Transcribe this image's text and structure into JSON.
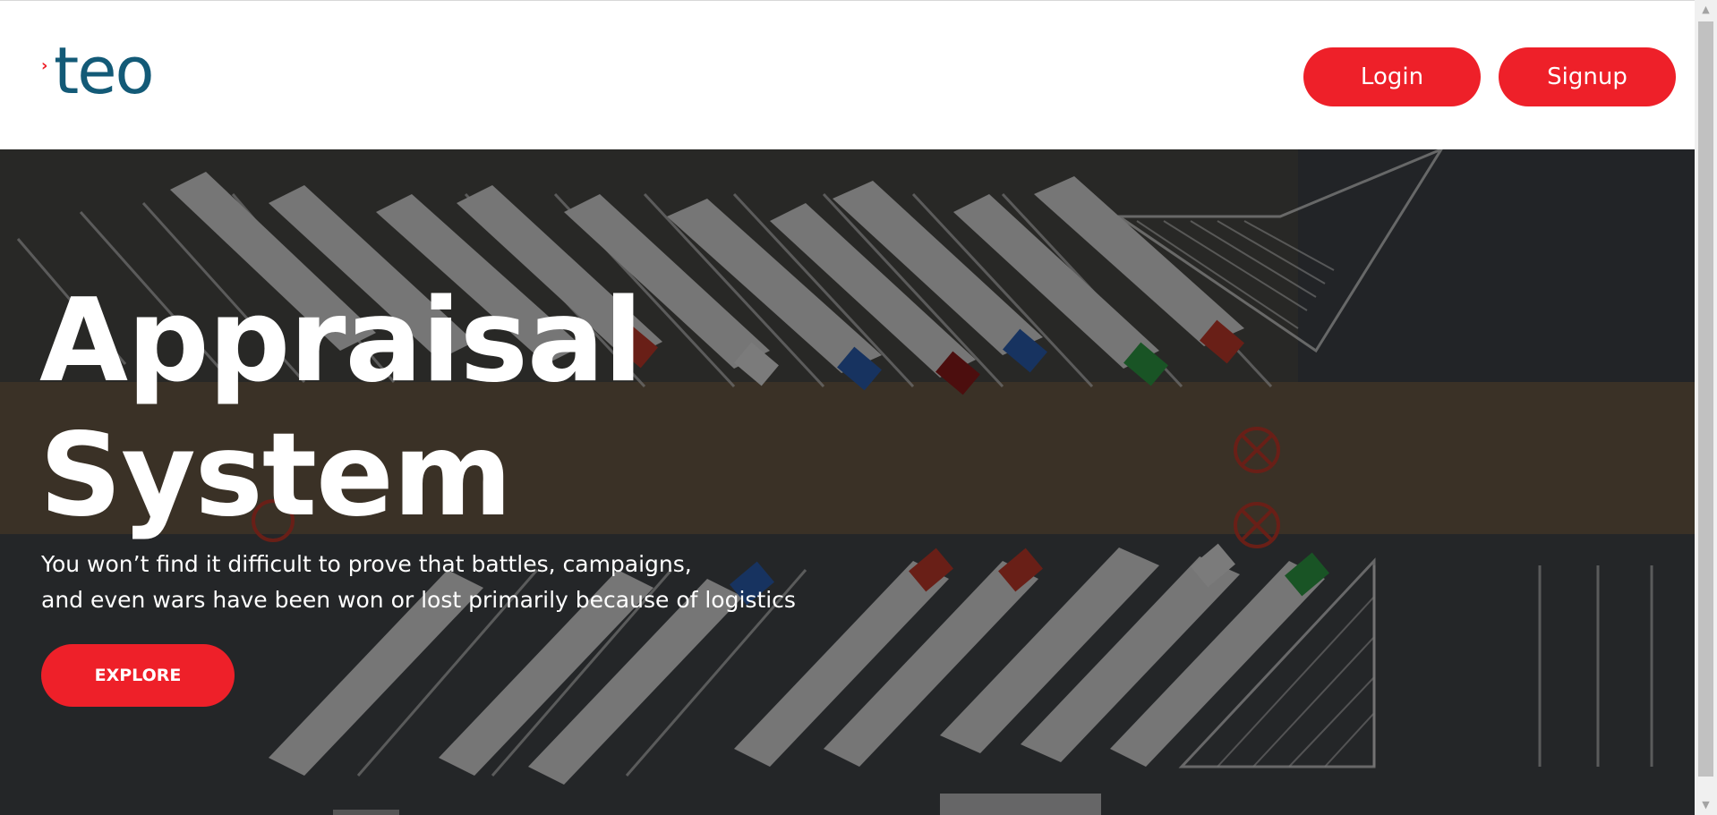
{
  "header": {
    "logo": {
      "arrow": "›",
      "text": "teo"
    },
    "login_label": "Login",
    "signup_label": "Signup"
  },
  "hero": {
    "title_line1": "Appraisal",
    "title_line2": "System",
    "subtitle_line1": "You won’t find it difficult to prove that battles, campaigns,",
    "subtitle_line2": "and even wars have been won or lost primarily because of logistics",
    "explore_label": "EXPLORE",
    "background_description_icon": "aerial-trucks-parking-image"
  },
  "scrollbar": {
    "up_icon": "▲",
    "down_icon": "▼"
  },
  "colors": {
    "accent": "#ee2029",
    "logo_text": "#135a77",
    "header_bg": "#ffffff"
  }
}
